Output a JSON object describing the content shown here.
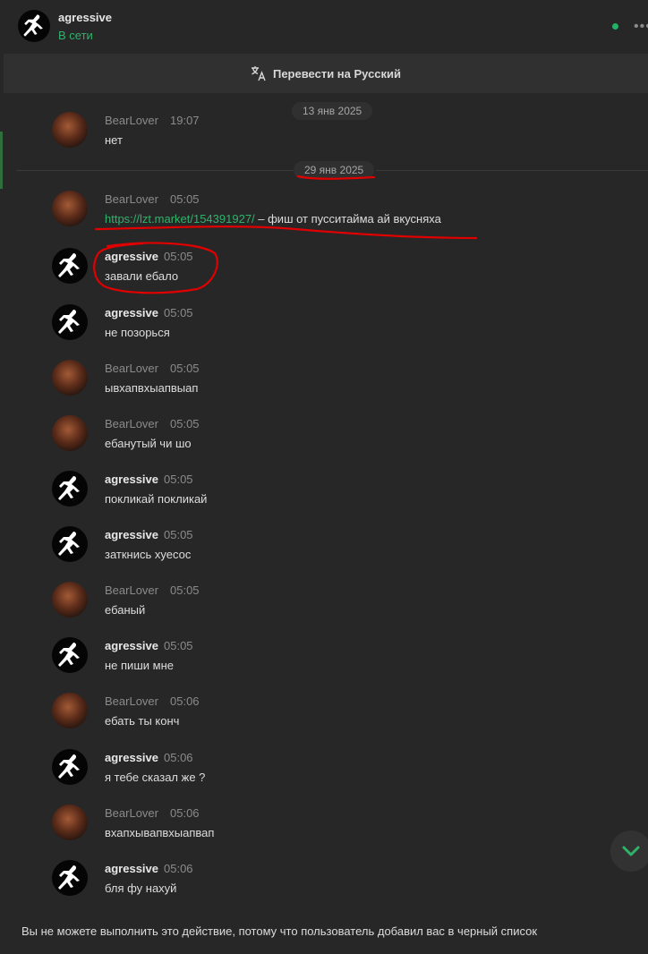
{
  "header": {
    "username": "agressive",
    "status": "В сети",
    "online_color": "#22b366",
    "more_icon": "more-dots-icon"
  },
  "translate": {
    "label": "Перевести на Русский",
    "icon": "translate-icon"
  },
  "dates": [
    "13 янв 2025",
    "29 янв 2025"
  ],
  "messages": [
    {
      "author": "BearLover",
      "time": "19:07",
      "text": "нет"
    },
    {
      "author": "BearLover",
      "time": "05:05",
      "link": "https://lzt.market/154391927/",
      "text": " – фиш от пусситайма ай вкусняха"
    },
    {
      "author": "agressive",
      "time": "05:05",
      "text": "завали ебало"
    },
    {
      "author": "agressive",
      "time": "05:05",
      "text": "не позорься"
    },
    {
      "author": "BearLover",
      "time": "05:05",
      "text": "ывхапвхыапвыап"
    },
    {
      "author": "BearLover",
      "time": "05:05",
      "text": "ебанутый чи шо"
    },
    {
      "author": "agressive",
      "time": "05:05",
      "text": "покликай покликай"
    },
    {
      "author": "agressive",
      "time": "05:05",
      "text": "заткнись хуесос"
    },
    {
      "author": "BearLover",
      "time": "05:05",
      "text": "ебаный"
    },
    {
      "author": "agressive",
      "time": "05:05",
      "text": "не пиши мне"
    },
    {
      "author": "BearLover",
      "time": "05:06",
      "text": "ебать ты конч"
    },
    {
      "author": "agressive",
      "time": "05:06",
      "text": "я тебе сказал же ?"
    },
    {
      "author": "BearLover",
      "time": "05:06",
      "text": "вхапхывапвхыапвап"
    },
    {
      "author": "agressive",
      "time": "05:06",
      "text": "бля фу нахуй"
    }
  ],
  "scroll_down_icon": "chevron-down-icon",
  "blocked_notice": "Вы не можете выполнить это действие, потому что пользователь добавил вас в черный список",
  "colors": {
    "background": "#272727",
    "accent_green": "#2fb36b",
    "annotation_red": "#e00000"
  }
}
